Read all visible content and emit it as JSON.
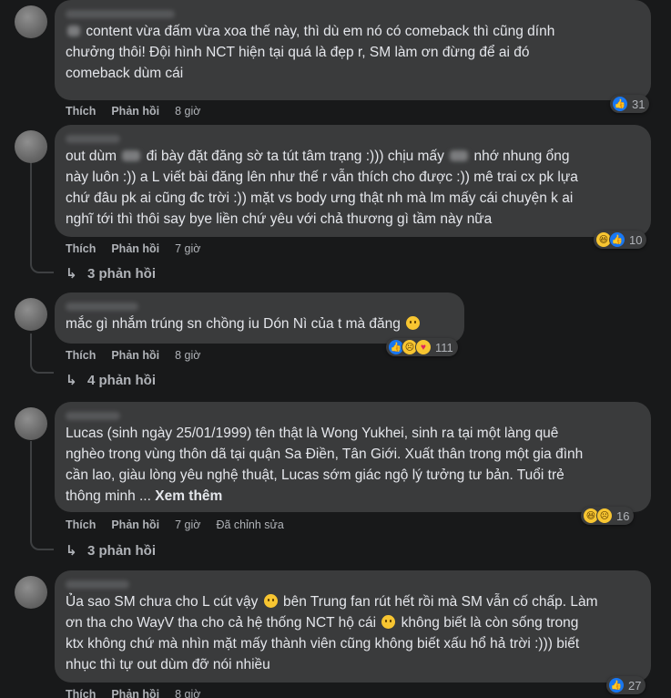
{
  "comments": [
    {
      "lines": [
        "content vừa đấm vừa xoa thế này, thì dù em nó có comeback thì cũng dính",
        "chưởng thôi! Đội hình NCT hiện tại quá là đẹp r, SM làm ơn đừng để ai đó",
        "comeback dùm cái"
      ],
      "like_label": "Thích",
      "reply_label": "Phản hồi",
      "time": "8 giờ",
      "reactions": [
        "like-icon"
      ],
      "reaction_count": "31"
    },
    {
      "lines": [
        "out dùm",
        "đi bày đặt đăng sờ ta tút tâm trạng :))) chịu mấy",
        "nhớ nhung ổng",
        "này luôn :)) a L viết bài đăng lên như thế r vẫn thích cho được :)) mê trai cx pk lựa",
        "chứ đâu pk ai cũng đc trời :)) mặt vs body ưng thật nh mà lm mấy cái chuyện k ai",
        "nghĩ tới thì thôi say bye liền chứ yêu với chả thương gì tầm này nữa"
      ],
      "like_label": "Thích",
      "reply_label": "Phản hồi",
      "time": "7 giờ",
      "reactions": [
        "haha-icon",
        "like-icon"
      ],
      "reaction_count": "10",
      "replies": "3 phản hồi"
    },
    {
      "lines": [
        "mắc gì nhắm trúng sn chồng iu Dón Nì của t mà đăng"
      ],
      "like_label": "Thích",
      "reply_label": "Phản hồi",
      "time": "8 giờ",
      "reactions": [
        "like-icon",
        "sad-icon",
        "care-icon"
      ],
      "reaction_count": "111",
      "replies": "4 phản hồi"
    },
    {
      "lines": [
        "Lucas (sinh ngày 25/01/1999) tên thật là Wong Yukhei, sinh ra tại một làng quê",
        "nghèo trong vùng thôn dã tại quận Sa Điền, Tân Giới. Xuất thân trong một gia đình",
        "cần lao, giàu lòng yêu nghệ thuật, Lucas sớm giác ngộ lý tưởng tư bản. Tuổi trẻ",
        "thông minh ..."
      ],
      "see_more": "Xem thêm",
      "like_label": "Thích",
      "reply_label": "Phản hồi",
      "time": "7 giờ",
      "edited": "Đã chỉnh sửa",
      "reactions": [
        "haha-icon",
        "sad-icon"
      ],
      "reaction_count": "16",
      "replies": "3 phản hồi"
    },
    {
      "lines": [
        "Ủa sao SM chưa cho L cút vậy",
        "bên Trung fan rút hết rồi mà SM vẫn cố chấp. Làm",
        "ơn tha cho WayV tha cho cả hệ thống NCT hộ cái",
        "không biết là còn sống trong",
        "ktx không chứ mà nhìn mặt mấy thành viên cũng không biết xấu hổ hả trời :))) biết",
        "nhục thì tự out dùm đỡ nói nhiều"
      ],
      "like_label": "Thích",
      "reply_label": "Phản hồi",
      "time": "8 giờ",
      "reactions": [
        "like-icon"
      ],
      "reaction_count": "27"
    }
  ]
}
